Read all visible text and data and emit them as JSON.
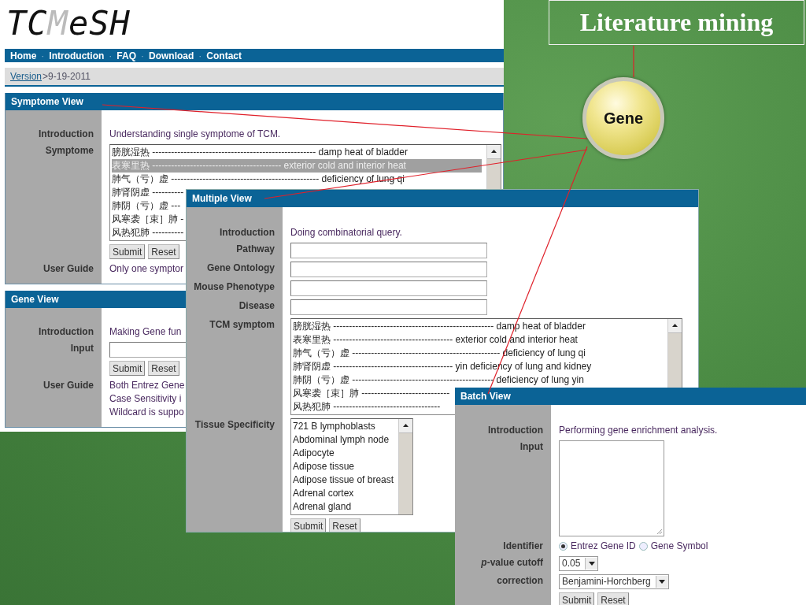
{
  "page": {
    "logo": [
      {
        "text": "TC",
        "kind": "dark"
      },
      {
        "text": "M",
        "kind": "light"
      },
      {
        "text": "eSH",
        "kind": "dark"
      }
    ],
    "nav": [
      {
        "kind": "link",
        "text": "Home"
      },
      {
        "kind": "separator",
        "text": "·"
      },
      {
        "kind": "link",
        "text": "Introduction"
      },
      {
        "kind": "separator",
        "text": "·"
      },
      {
        "kind": "link",
        "text": "FAQ"
      },
      {
        "kind": "separator",
        "text": "·"
      },
      {
        "kind": "link",
        "text": "Download"
      },
      {
        "kind": "separator",
        "text": "·"
      },
      {
        "kind": "link",
        "text": "Contact"
      }
    ],
    "version": {
      "link": "Version",
      "value": ">9-19-2011"
    },
    "views": [
      {
        "title": "Symptome View",
        "rows": [
          {
            "kind": "text",
            "label": "Introduction",
            "text": "Understanding single symptome of TCM."
          },
          {
            "kind": "list",
            "label": "Symptome",
            "items": [
              {
                "text": "膀胱湿热 ---------------------------------------------------- damp heat of bladder",
                "selected": false
              },
              {
                "text": "表寒里热 ----------------------------------------- exterior cold and interior heat",
                "selected": true
              },
              {
                "text": "肺气（亏）虚 ----------------------------------------------- deficiency of lung qi",
                "selected": false
              },
              {
                "text": "肺肾阴虚 ----------",
                "selected": false
              },
              {
                "text": "肺阴（亏）虚 ---",
                "selected": false
              },
              {
                "text": "风寒袭［束］肺 -",
                "selected": false
              },
              {
                "text": "风热犯肺 ----------",
                "selected": false
              }
            ]
          },
          {
            "kind": "buttons",
            "buttons": [
              "Submit",
              "Reset"
            ]
          },
          {
            "kind": "lines",
            "label": "User Guide",
            "lines": [
              "Only one symptor"
            ]
          }
        ]
      },
      {
        "title": "Gene View",
        "rows": [
          {
            "kind": "text",
            "label": "Introduction",
            "text": "Making Gene fun"
          },
          {
            "kind": "field",
            "label": "Input"
          },
          {
            "kind": "buttons",
            "buttons": [
              "Submit",
              "Reset"
            ]
          },
          {
            "kind": "lines",
            "label": "User Guide",
            "lines": [
              "Both Entrez Gene",
              "Case Sensitivity i",
              "Wildcard is suppo"
            ]
          }
        ]
      }
    ]
  },
  "multiple_view": {
    "title": "Multiple View",
    "rows": [
      {
        "kind": "text",
        "label": "Introduction",
        "text": "Doing combinatorial query."
      },
      {
        "kind": "field",
        "label": "Pathway"
      },
      {
        "kind": "field",
        "label": "Gene Ontology"
      },
      {
        "kind": "field",
        "label": "Mouse Phenotype"
      },
      {
        "kind": "field",
        "label": "Disease"
      },
      {
        "kind": "list",
        "label": "TCM symptom",
        "items": [
          {
            "text": "膀胱湿热 --------------------------------------------------- damp heat of bladder",
            "selected": false
          },
          {
            "text": "表寒里热 -------------------------------------- exterior cold and interior heat",
            "selected": false
          },
          {
            "text": "肺气（亏）虚 ----------------------------------------------- deficiency of lung qi",
            "selected": false
          },
          {
            "text": "肺肾阴虚 -------------------------------------- yin deficiency of lung and kidney",
            "selected": false
          },
          {
            "text": "肺阴（亏）虚 --------------------------------------------- deficiency of lung yin",
            "selected": false
          },
          {
            "text": "风寒袭［束］肺 ----------------------------",
            "selected": false
          },
          {
            "text": "风热犯肺 ----------------------------------",
            "selected": false
          }
        ]
      },
      {
        "kind": "list",
        "label": "Tissue Specificity",
        "items": [
          {
            "text": "721 B lymphoblasts",
            "selected": false
          },
          {
            "text": "Abdominal lymph node",
            "selected": false
          },
          {
            "text": "Adipocyte",
            "selected": false
          },
          {
            "text": "Adipose tissue",
            "selected": false
          },
          {
            "text": "Adipose tissue of breast",
            "selected": false
          },
          {
            "text": "Adrenal cortex",
            "selected": false
          },
          {
            "text": "Adrenal gland",
            "selected": false
          }
        ]
      },
      {
        "kind": "buttons",
        "buttons": [
          "Submit",
          "Reset"
        ]
      }
    ]
  },
  "batch_view": {
    "title": "Batch View",
    "rows": [
      {
        "kind": "text",
        "label": "Introduction",
        "text": "Performing gene enrichment analysis."
      },
      {
        "kind": "textarea",
        "label": "Input"
      },
      {
        "kind": "radio",
        "label": "Identifier",
        "options": [
          {
            "text": "Entrez Gene ID",
            "selected": true
          },
          {
            "text": "Gene Symbol",
            "selected": false
          }
        ]
      },
      {
        "kind": "select",
        "label": "*p*-value cutoff",
        "value": "0.05"
      },
      {
        "kind": "select",
        "label": "correction",
        "value": "Benjamini-Horchberg"
      },
      {
        "kind": "buttons",
        "buttons": [
          "Submit",
          "Reset"
        ]
      }
    ]
  },
  "slide_title": "Literature mining",
  "bubble": {
    "label": "Gene"
  }
}
